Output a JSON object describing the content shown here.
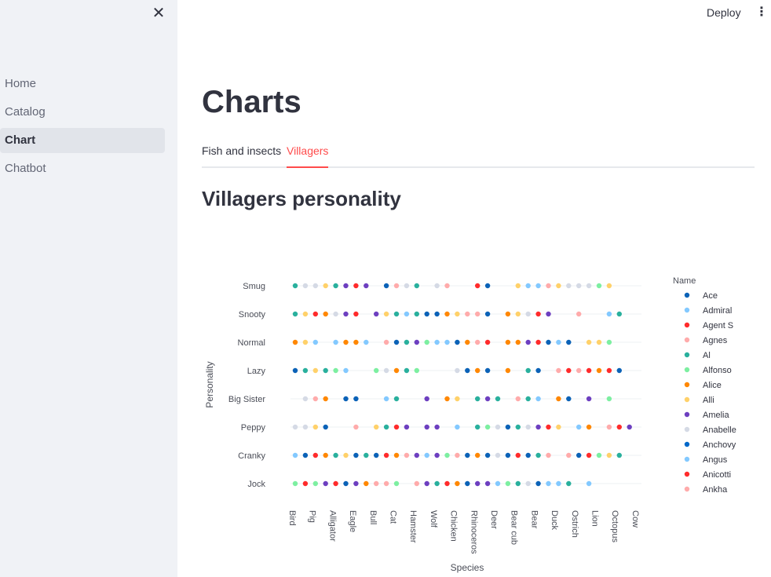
{
  "sidebar": {
    "close_label": "✕",
    "items": [
      {
        "label": "Home",
        "active": false
      },
      {
        "label": "Catalog",
        "active": false
      },
      {
        "label": "Chart",
        "active": true
      },
      {
        "label": "Chatbot",
        "active": false
      }
    ]
  },
  "header": {
    "deploy_label": "Deploy",
    "menu_label": "⋮"
  },
  "main": {
    "title": "Charts",
    "tabs": [
      {
        "label": "Fish and insects",
        "active": false
      },
      {
        "label": "Villagers",
        "active": true
      }
    ],
    "section_title": "Villagers personality"
  },
  "colors": {
    "accent": "#ff4b4b",
    "sidebar_bg": "#f0f2f6"
  },
  "chart_data": {
    "type": "scatter",
    "xlabel": "Species",
    "ylabel": "Personality",
    "x_categories": [
      "Bird",
      "Pig",
      "Alligator",
      "Eagle",
      "Bull",
      "Cat",
      "Hamster",
      "Wolf",
      "Chicken",
      "Rhinoceros",
      "Deer",
      "Bear cub",
      "Bear",
      "Duck",
      "Ostrich",
      "Lion",
      "Octopus",
      "Cow"
    ],
    "y_categories": [
      "Smug",
      "Snooty",
      "Normal",
      "Lazy",
      "Big Sister",
      "Peppy",
      "Cranky",
      "Jock"
    ],
    "legend_title": "Name",
    "legend_position": "right",
    "legend": [
      {
        "name": "Ace",
        "color": "#0b62b7"
      },
      {
        "name": "Admiral",
        "color": "#83c9ff"
      },
      {
        "name": "Agent S",
        "color": "#ff2b2b"
      },
      {
        "name": "Agnes",
        "color": "#ffabab"
      },
      {
        "name": "Al",
        "color": "#29b09d"
      },
      {
        "name": "Alfonso",
        "color": "#7defa1"
      },
      {
        "name": "Alice",
        "color": "#ff8700"
      },
      {
        "name": "Alli",
        "color": "#ffd16a"
      },
      {
        "name": "Amelia",
        "color": "#6d3fc0"
      },
      {
        "name": "Anabelle",
        "color": "#d5dae5"
      },
      {
        "name": "Anchovy",
        "color": "#0068c9"
      },
      {
        "name": "Angus",
        "color": "#83c9ff"
      },
      {
        "name": "Anicotti",
        "color": "#ff2b2b"
      },
      {
        "name": "Ankha",
        "color": "#ffabab"
      }
    ],
    "rows": [
      {
        "personality": "Smug",
        "colors": "4 9 9 7 4 8 2 8 _ 0 3 9 4 _ 9 3 _ _ 2 0 _ _ 7 1 1 3 7 9 9 9 5 7 _ _ _ _ _ _"
      },
      {
        "personality": "Snooty",
        "colors": "4 7 2 6 9 8 2 _ 8 7 4 1 4 0 0 6 7 3 3 0 _ 6 7 9 2 8 _ _ 3 _ _ 1 4 _ _ _ _ _"
      },
      {
        "personality": "Normal",
        "colors": "6 7 1 _ 1 6 6 1 _ 3 0 4 8 5 1 1 0 6 3 2 _ 6 6 8 2 0 1 0 _ 7 7 5 _ _ _ _ _ _"
      },
      {
        "personality": "Lazy",
        "colors": "0 4 7 4 5 1 _ _ 5 9 6 4 5 _ _ _ 9 0 6 0 _ 6 _ 4 0 _ 3 2 3 2 6 2 0 _ _ _ _ _"
      },
      {
        "personality": "Big Sister",
        "colors": "_ 9 3 6 _ 0 0 _ _ 1 4 _ _ 8 _ 6 7 _ 4 8 4 _ 3 4 1 _ 6 0 _ 8 _ 5 _ _ _ _ _ _"
      },
      {
        "personality": "Peppy",
        "colors": "9 9 7 0 _ _ 3 _ 7 4 2 8 _ 8 8 _ 1 _ 4 5 9 0 4 9 8 2 7 _ 1 6 _ 3 2 8 _ _ _ _"
      },
      {
        "personality": "Cranky",
        "colors": "1 0 2 6 4 7 0 4 0 2 6 3 8 1 8 5 3 0 6 0 9 0 2 0 4 3 _ 3 0 2 5 7 4 _ _ _ _ _"
      },
      {
        "personality": "Jock",
        "colors": "5 2 5 8 2 0 8 6 3 3 5 _ 3 8 4 2 6 0 8 8 1 5 4 9 0 1 1 4 _ 1 _ _ _ _ _ _ _ _"
      }
    ]
  }
}
